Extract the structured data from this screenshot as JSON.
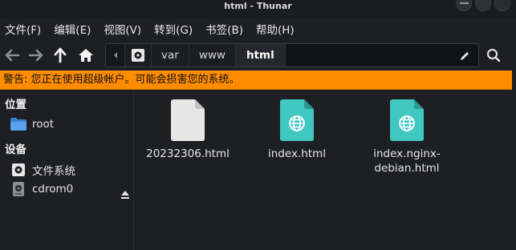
{
  "window": {
    "title": "html - Thunar"
  },
  "menubar": {
    "items": [
      "文件(F)",
      "编辑(E)",
      "视图(V)",
      "转到(G)",
      "书签(B)",
      "帮助(H)"
    ]
  },
  "toolbar": {
    "icons": [
      "back-arrow-icon",
      "forward-arrow-icon",
      "up-arrow-icon",
      "home-icon",
      "edit-pencil-icon",
      "search-icon"
    ],
    "path": [
      "var",
      "www",
      "html"
    ],
    "active_segment": "html"
  },
  "warning": {
    "text": "警告: 您正在使用超级帐户。可能会损害您的系统。",
    "color": "#ff8c00"
  },
  "sidebar": {
    "places_header": "位置",
    "places": [
      {
        "label": "root",
        "icon": "folder-home-icon"
      }
    ],
    "devices_header": "设备",
    "devices": [
      {
        "label": "文件系统",
        "icon": "drive-icon"
      },
      {
        "label": "cdrom0",
        "icon": "optical-drive-icon"
      }
    ]
  },
  "files": [
    {
      "name": "20232306.html",
      "icon": "generic-file-icon"
    },
    {
      "name": "index.html",
      "icon": "html-globe-file-icon"
    },
    {
      "name": "index.nginx-debian.html",
      "icon": "html-globe-file-icon"
    }
  ],
  "file_name_lines": [
    [
      "20232306.html"
    ],
    [
      "index.html"
    ],
    [
      "index.nginx-",
      "debian.html"
    ]
  ]
}
